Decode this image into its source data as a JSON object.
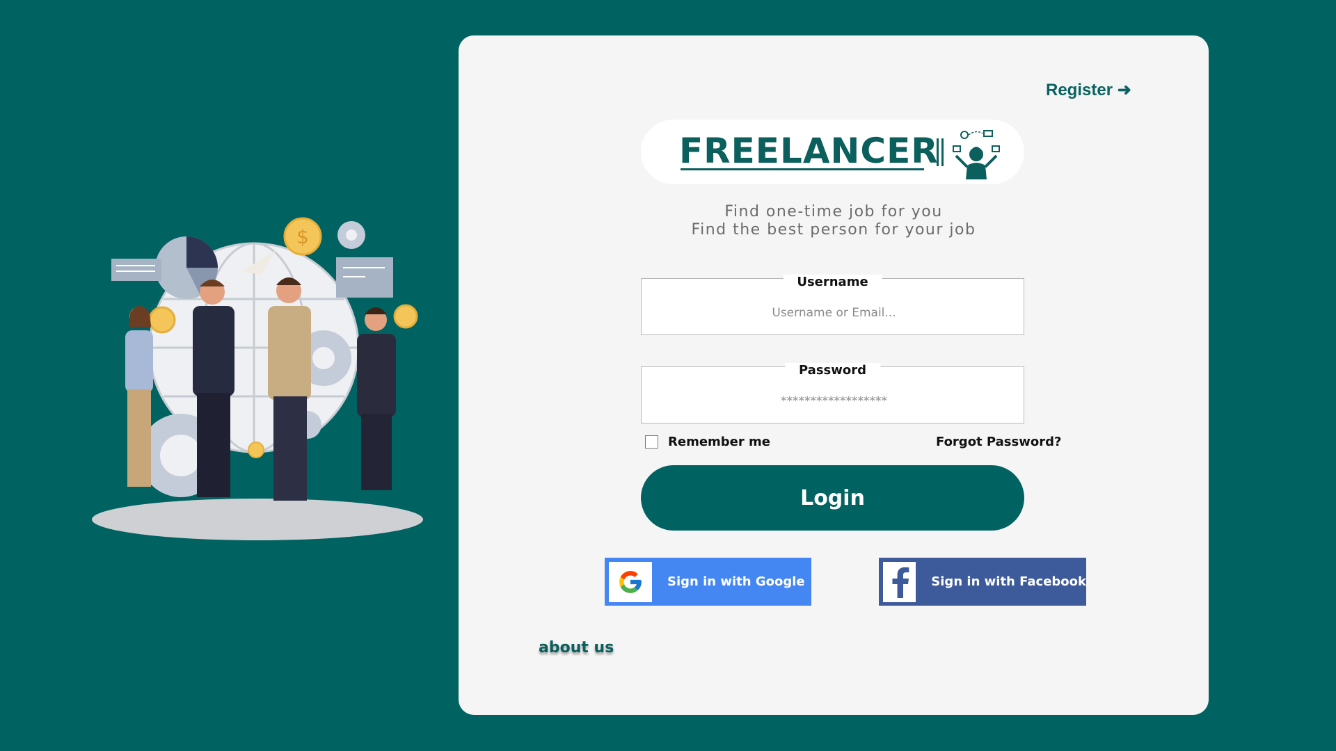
{
  "header": {
    "register_label": "Register ➜"
  },
  "logo": {
    "text": "FREELANCER",
    "icon": "freelancer-juggling-icon"
  },
  "tagline": {
    "line1": "Find one-time job for you",
    "line2": "Find the best person for your job"
  },
  "form": {
    "username": {
      "label": "Username",
      "placeholder": "Username or Email..."
    },
    "password": {
      "label": "Password",
      "placeholder": "******************"
    },
    "remember_label": "Remember me",
    "forgot_label": "Forgot  Password?",
    "login_label": "Login"
  },
  "social": {
    "google_label": "Sign in with Google",
    "facebook_label": "Sign in with Facebook"
  },
  "footer": {
    "about_label": "about us"
  },
  "colors": {
    "background": "#006261",
    "card": "#f5f5f5",
    "primary": "#006261",
    "google": "#4486f2",
    "facebook": "#3d5a9a"
  }
}
